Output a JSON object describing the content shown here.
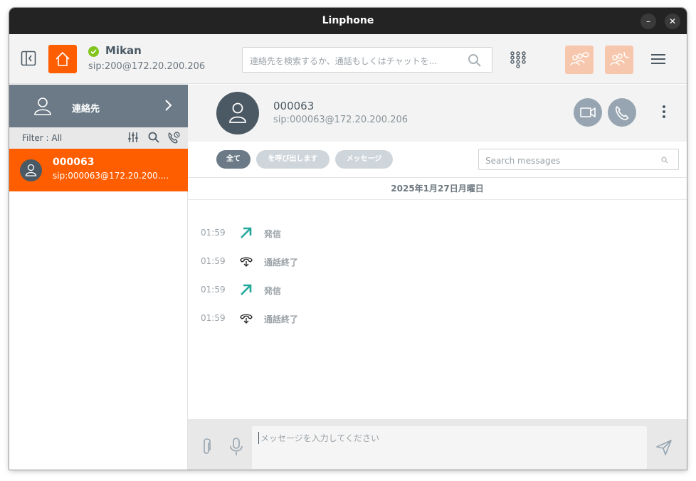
{
  "window": {
    "title": "Linphone",
    "minimize": "–",
    "close": "✕"
  },
  "topbar": {
    "user_name": "Mikan",
    "user_sip": "sip:200@172.20.200.206",
    "search_placeholder": "連絡先を検索するか、通話もしくはチャットを...",
    "icons": [
      "sidebar-toggle-icon",
      "home-icon",
      "search-icon",
      "dialpad-icon",
      "conference-chat-icon",
      "conference-call-icon",
      "hamburger-menu-icon"
    ],
    "accent": "#ff5e00"
  },
  "sidebar": {
    "contacts_label": "連絡先",
    "filter_label": "Filter : All",
    "contacts": [
      {
        "name": "000063",
        "sip": "sip:000063@172.20.200...."
      }
    ]
  },
  "conversation": {
    "peer_name": "000063",
    "peer_sip": "sip:000063@172.20.200.206",
    "tabs": [
      "全て",
      "を呼び出します",
      "メッセージ"
    ],
    "search_placeholder": "Search messages",
    "date": "2025年1月27日月曜日",
    "events": [
      {
        "time": "01:59",
        "type": "outgoing",
        "text": "発信"
      },
      {
        "time": "01:59",
        "type": "ended",
        "text": "通話終了"
      },
      {
        "time": "01:59",
        "type": "outgoing",
        "text": "発信"
      },
      {
        "time": "01:59",
        "type": "ended",
        "text": "通話終了"
      }
    ],
    "composer_placeholder": "メッセージを入力してください"
  }
}
